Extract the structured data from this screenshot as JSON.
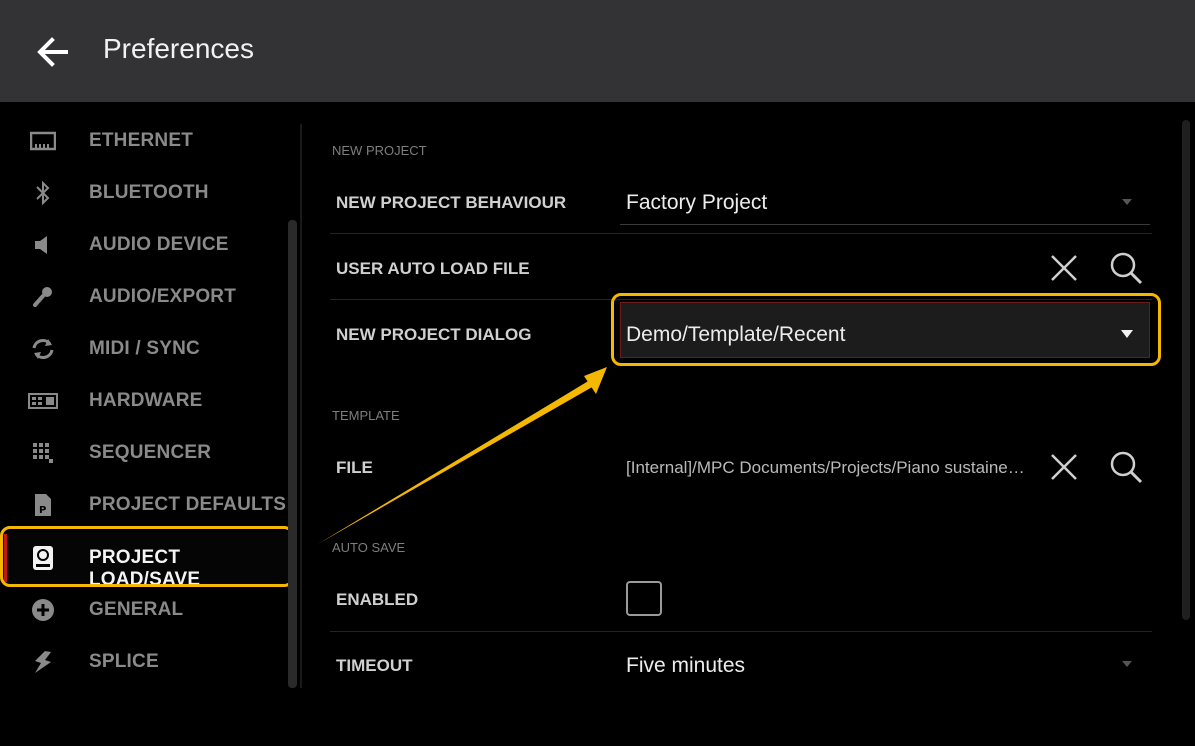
{
  "header": {
    "title": "Preferences",
    "back_icon": "back-arrow-icon"
  },
  "sidebar": {
    "items": [
      {
        "label": "ETHERNET",
        "icon": "ethernet-icon"
      },
      {
        "label": "BLUETOOTH",
        "icon": "bluetooth-icon"
      },
      {
        "label": "AUDIO DEVICE",
        "icon": "speaker-icon"
      },
      {
        "label": "AUDIO/EXPORT",
        "icon": "microphone-icon"
      },
      {
        "label": "MIDI / SYNC",
        "icon": "sync-icon"
      },
      {
        "label": "HARDWARE",
        "icon": "hardware-icon"
      },
      {
        "label": "SEQUENCER",
        "icon": "grid-icon"
      },
      {
        "label": "PROJECT DEFAULTS",
        "icon": "document-icon"
      },
      {
        "label": "PROJECT LOAD/SAVE",
        "icon": "drive-icon",
        "active": true
      },
      {
        "label": "GENERAL",
        "icon": "plus-circle-icon"
      },
      {
        "label": "SPLICE",
        "icon": "splice-icon"
      }
    ]
  },
  "main": {
    "new_project": {
      "heading": "NEW PROJECT",
      "behaviour_label": "NEW PROJECT BEHAVIOUR",
      "behaviour_value": "Factory Project",
      "auto_load_label": "USER AUTO LOAD FILE",
      "dialog_label": "NEW PROJECT DIALOG",
      "dialog_value": "Demo/Template/Recent"
    },
    "template": {
      "heading": "TEMPLATE",
      "file_label": "FILE",
      "file_value": "[Internal]/MPC Documents/Projects/Piano sustained.xpj"
    },
    "auto_save": {
      "heading": "AUTO SAVE",
      "enabled_label": "ENABLED",
      "enabled": false,
      "timeout_label": "TIMEOUT",
      "timeout_value": "Five minutes"
    }
  },
  "colors": {
    "header_bg": "#333335",
    "highlight": "#f5b800",
    "active_accent": "#c01818"
  }
}
